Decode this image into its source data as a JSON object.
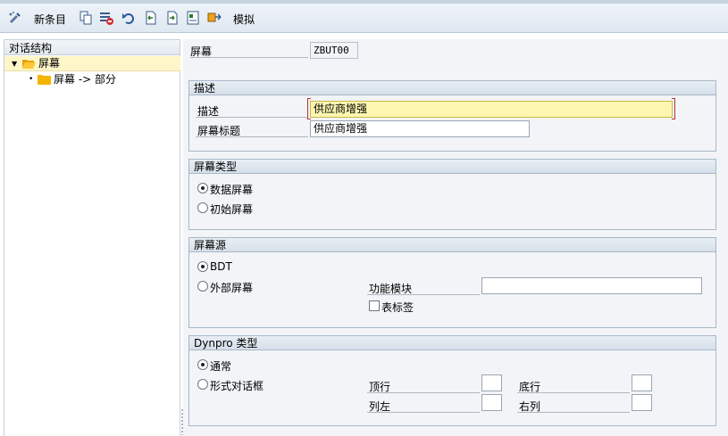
{
  "toolbar": {
    "new_entries_label": "新条目",
    "simulate_label": "模拟",
    "icons": [
      "display-change-icon",
      "copy-icon",
      "delete-icon",
      "undo-icon",
      "previous-entry-icon",
      "next-entry-icon",
      "other-entry-icon",
      "transport-icon"
    ]
  },
  "dialog_structure": {
    "header": "对话结构",
    "nodes": [
      {
        "label": "屏幕",
        "level": 0,
        "selected": true,
        "expanded": true
      },
      {
        "label": "屏幕 -> 部分",
        "level": 1,
        "selected": false
      }
    ]
  },
  "screen": {
    "label": "屏幕",
    "value": "ZBUT00"
  },
  "description_group": {
    "title": "描述",
    "description_label": "描述",
    "description_value": "供应商增强",
    "screen_title_label": "屏幕标题",
    "screen_title_value": "供应商增强"
  },
  "screen_type_group": {
    "title": "屏幕类型",
    "options": [
      {
        "label": "数据屏幕",
        "selected": true
      },
      {
        "label": "初始屏幕",
        "selected": false
      }
    ]
  },
  "screen_source_group": {
    "title": "屏幕源",
    "options": [
      {
        "label": "BDT",
        "selected": true
      },
      {
        "label": "外部屏幕",
        "selected": false
      }
    ],
    "function_module_label": "功能模块",
    "function_module_value": "",
    "table_tab_label": "表标签",
    "table_tab_checked": false
  },
  "dynpro_group": {
    "title": "Dynpro 类型",
    "options": [
      {
        "label": "通常",
        "selected": true
      },
      {
        "label": "形式对话框",
        "selected": false
      }
    ],
    "top_row_label": "顶行",
    "bottom_row_label": "底行",
    "left_col_label": "列左",
    "right_col_label": "右列",
    "top_row_value": "",
    "bottom_row_value": "",
    "left_col_value": "",
    "right_col_value": ""
  },
  "colors": {
    "toolbar_bg": "#e6edf4",
    "group_border": "#a8b8c8",
    "selected_row": "#fdf6c8",
    "active_field": "#fdf6b0",
    "folder": "#f5b400"
  }
}
